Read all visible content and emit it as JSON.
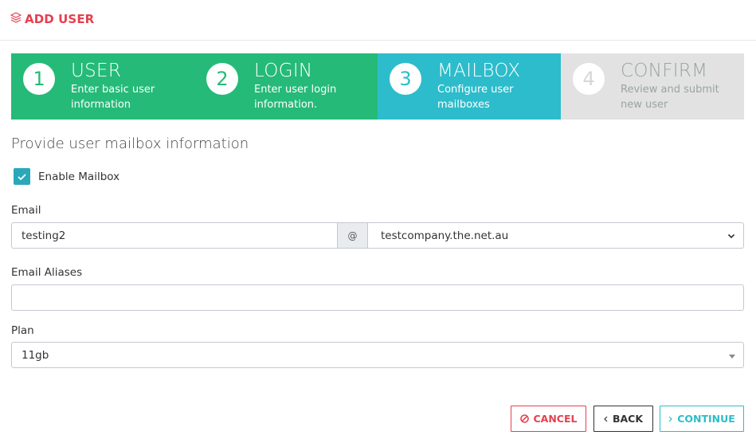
{
  "header": {
    "title": "ADD USER",
    "icon": "layers-icon",
    "color": "#e5404f"
  },
  "steps": [
    {
      "number": "1",
      "title": "USER",
      "description": "Enter basic user information",
      "state": "done"
    },
    {
      "number": "2",
      "title": "LOGIN",
      "description": "Enter user login information.",
      "state": "done"
    },
    {
      "number": "3",
      "title": "MAILBOX",
      "description": "Configure user mailboxes",
      "state": "active"
    },
    {
      "number": "4",
      "title": "CONFIRM",
      "description": "Review and submit new user",
      "state": "pending"
    }
  ],
  "colors": {
    "done": "#25ba78",
    "active": "#2dbccb",
    "pending": "#e2e2e2",
    "danger": "#e5404f"
  },
  "form": {
    "section_title": "Provide user mailbox information",
    "enable_mailbox": {
      "label": "Enable Mailbox",
      "checked": true
    },
    "email": {
      "label": "Email",
      "local_part": "testing2",
      "at_symbol": "@",
      "domain": "testcompany.the.net.au"
    },
    "aliases": {
      "label": "Email Aliases",
      "value": ""
    },
    "plan": {
      "label": "Plan",
      "value": "11gb"
    }
  },
  "actions": {
    "cancel": "CANCEL",
    "back": "BACK",
    "continue": "CONTINUE"
  }
}
